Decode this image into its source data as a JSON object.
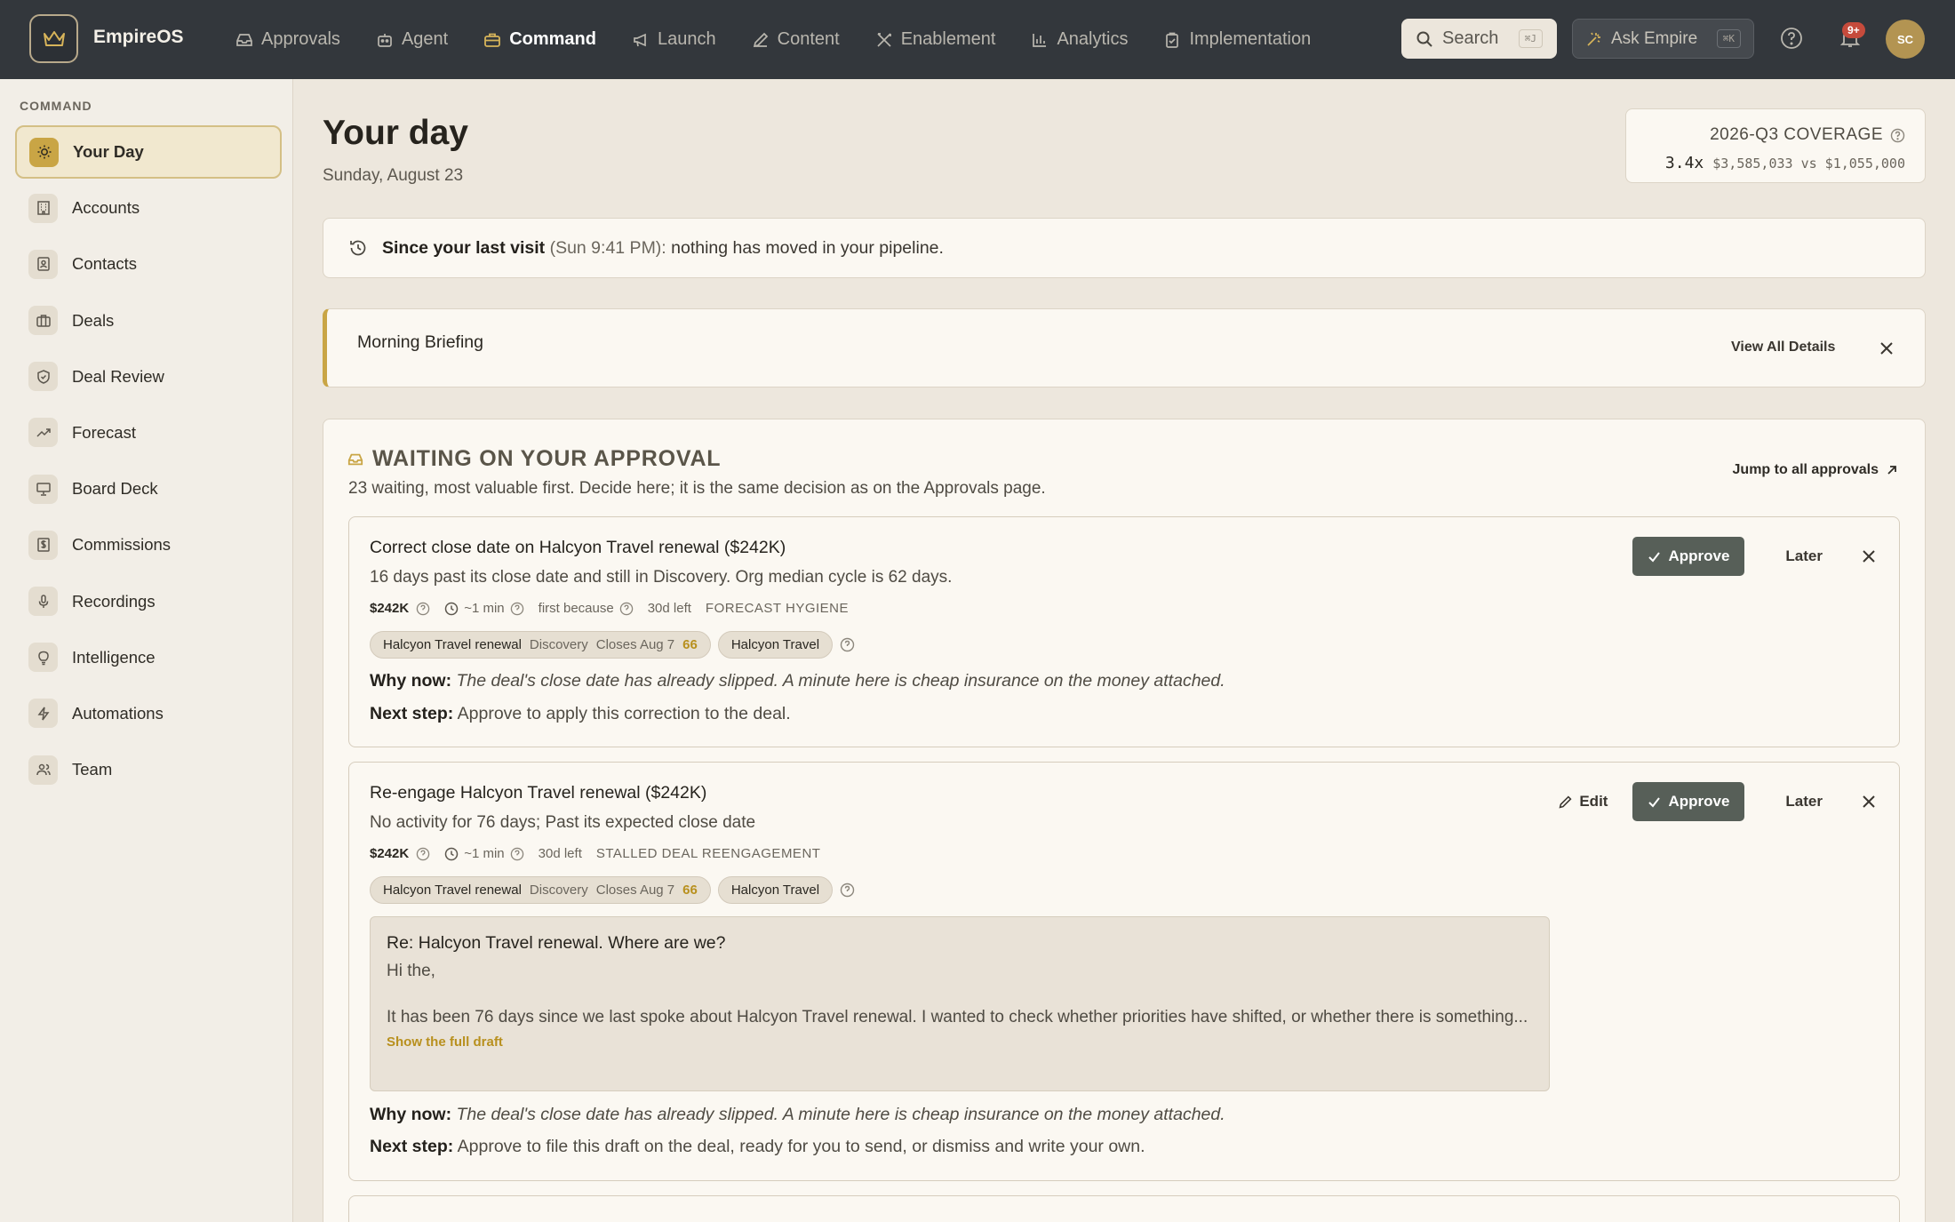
{
  "brand": {
    "name": "EmpireOS"
  },
  "nav": [
    {
      "label": "Approvals",
      "icon": "inbox-icon"
    },
    {
      "label": "Agent",
      "icon": "robot-icon"
    },
    {
      "label": "Command",
      "icon": "briefcase-icon",
      "active": true
    },
    {
      "label": "Launch",
      "icon": "megaphone-icon"
    },
    {
      "label": "Content",
      "icon": "pencil-icon"
    },
    {
      "label": "Enablement",
      "icon": "tools-icon"
    },
    {
      "label": "Analytics",
      "icon": "bar-chart-icon"
    },
    {
      "label": "Implementation",
      "icon": "clipboard-icon"
    }
  ],
  "topbar": {
    "search_label": "Search",
    "search_kbd": "⌘J",
    "ask_label": "Ask Empire",
    "ask_kbd": "⌘K",
    "notif_badge": "9+",
    "avatar_initials": "SC"
  },
  "sidebar": {
    "heading": "COMMAND",
    "items": [
      {
        "label": "Your Day",
        "icon": "sun-icon",
        "active": true
      },
      {
        "label": "Accounts",
        "icon": "building-icon"
      },
      {
        "label": "Contacts",
        "icon": "contact-card-icon"
      },
      {
        "label": "Deals",
        "icon": "briefcase-icon"
      },
      {
        "label": "Deal Review",
        "icon": "shield-check-icon"
      },
      {
        "label": "Forecast",
        "icon": "trend-up-icon"
      },
      {
        "label": "Board Deck",
        "icon": "presentation-icon"
      },
      {
        "label": "Commissions",
        "icon": "dollar-receipt-icon"
      },
      {
        "label": "Recordings",
        "icon": "microphone-icon"
      },
      {
        "label": "Intelligence",
        "icon": "lightbulb-icon"
      },
      {
        "label": "Automations",
        "icon": "bolt-icon"
      },
      {
        "label": "Team",
        "icon": "users-icon"
      }
    ]
  },
  "page": {
    "title": "Your day",
    "date": "Sunday, August 23"
  },
  "coverage": {
    "label": "2026-Q3 COVERAGE",
    "ratio": "3.4x",
    "amounts": "$3,585,033 vs $1,055,000"
  },
  "since": {
    "bold": "Since your last visit",
    "time": "(Sun 9:41 PM):",
    "text": "nothing has moved in your pipeline."
  },
  "briefing": {
    "title": "Morning Briefing",
    "link": "View All Details"
  },
  "approvals": {
    "heading": "WAITING ON YOUR APPROVAL",
    "subtitle": "23 waiting, most valuable first. Decide here; it is the same decision as on the Approvals page.",
    "jump_label": "Jump to all approvals",
    "approve_label": "Approve",
    "later_label": "Later",
    "edit_label": "Edit",
    "why_label": "Why now:",
    "next_label": "Next step:",
    "items": [
      {
        "title": "Correct close date on Halcyon Travel renewal ($242K)",
        "desc": "16 days past its close date and still in Discovery. Org median cycle is 62 days.",
        "amount": "$242K",
        "time": "~1 min",
        "first_because": "first because",
        "left": "30d left",
        "tag": "FORECAST HYGIENE",
        "deal_chip": {
          "name": "Halcyon Travel renewal",
          "stage": "Discovery",
          "closes": "Closes Aug 7",
          "score": "66"
        },
        "account_chip": "Halcyon Travel",
        "why": "The deal's close date has already slipped. A minute here is cheap insurance on the money attached.",
        "next": "Approve to apply this correction to the deal."
      },
      {
        "title": "Re-engage Halcyon Travel renewal ($242K)",
        "desc": "No activity for 76 days; Past its expected close date",
        "amount": "$242K",
        "time": "~1 min",
        "left": "30d left",
        "tag": "STALLED DEAL REENGAGEMENT",
        "deal_chip": {
          "name": "Halcyon Travel renewal",
          "stage": "Discovery",
          "closes": "Closes Aug 7",
          "score": "66"
        },
        "account_chip": "Halcyon Travel",
        "draft": {
          "subject": "Re: Halcyon Travel renewal. Where are we?",
          "body": "Hi the,\n\nIt has been 76 days since we last spoke about Halcyon Travel renewal. I wanted to check whether priorities have shifted, or whether there is something...",
          "more": "Show the full draft"
        },
        "why": "The deal's close date has already slipped. A minute here is cheap insurance on the money attached.",
        "next": "Approve to file this draft on the deal, ready for you to send, or dismiss and write your own."
      }
    ]
  },
  "colors": {
    "topbar": "#33373c",
    "accent": "#c9a545",
    "approve": "#575f58",
    "background": "#ede7dd"
  }
}
